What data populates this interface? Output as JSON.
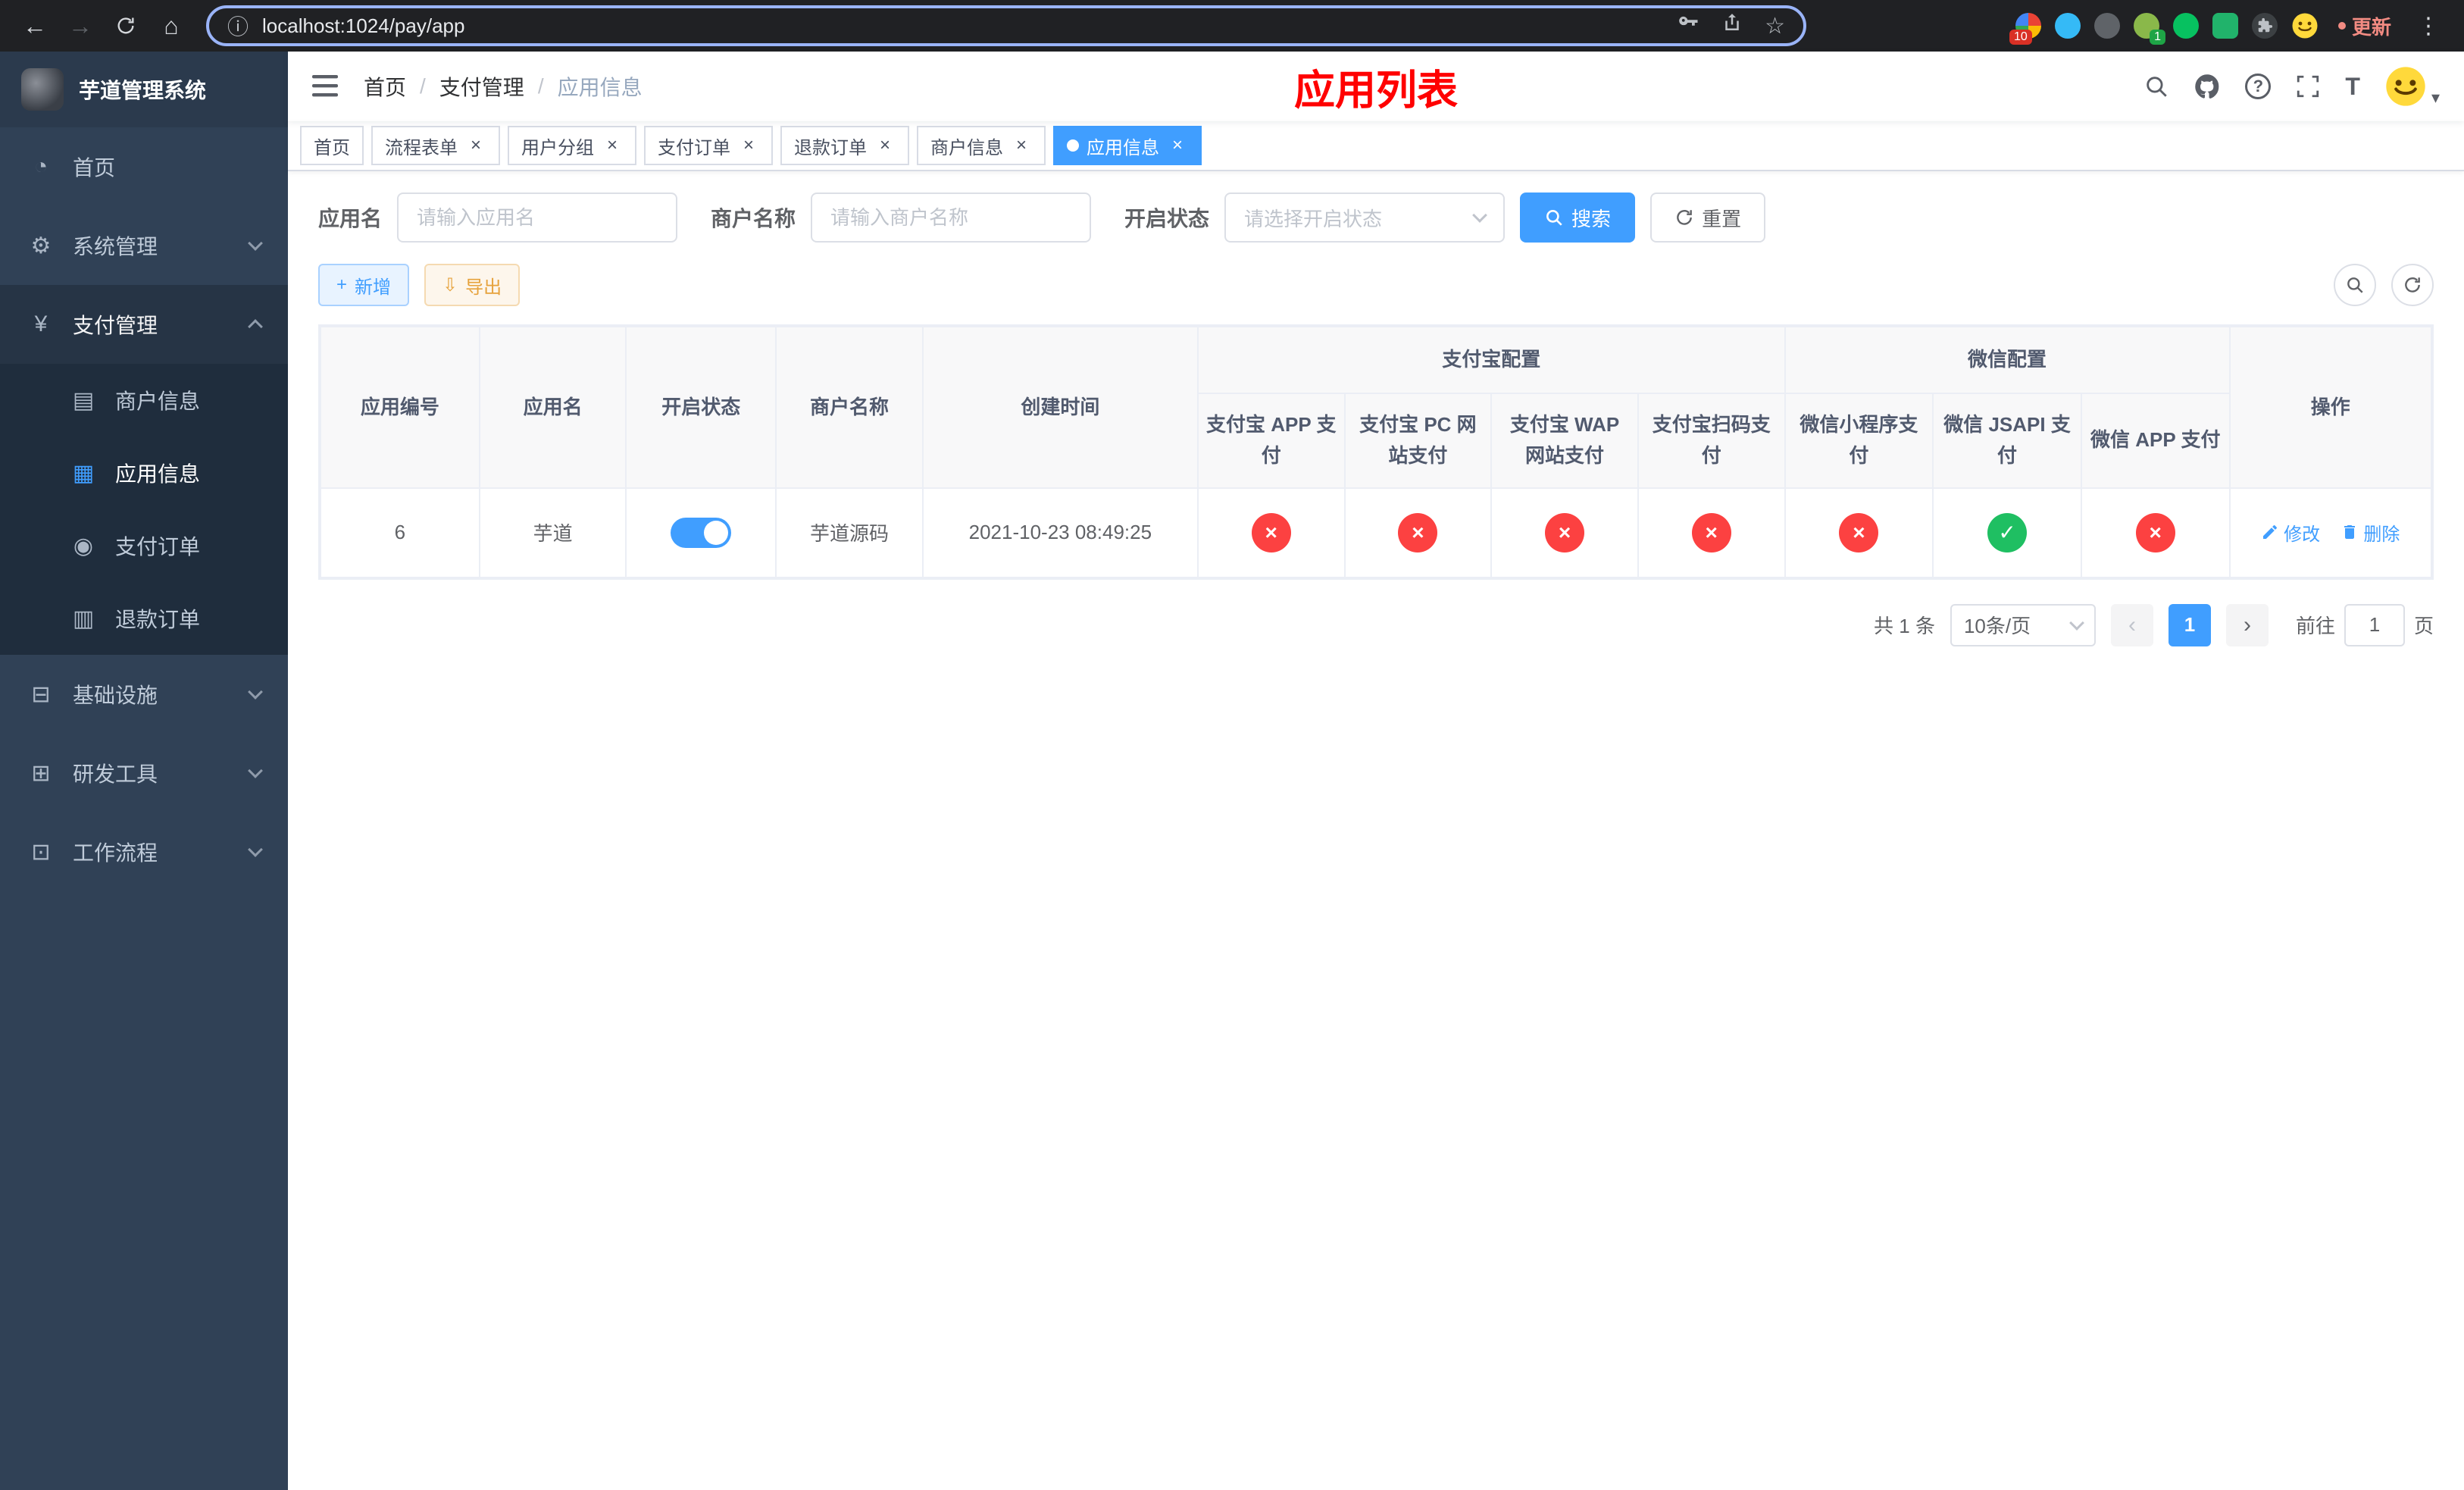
{
  "colors": {
    "accent": "#409eff",
    "danger": "#fc4141",
    "success": "#1fbf62",
    "title_red": "#ff0000",
    "sidebar_bg": "#304156",
    "submenu_bg": "#1f2d3d"
  },
  "icons": {
    "back": "←",
    "forward": "→",
    "home": "⌂",
    "info": "ⓘ",
    "star": "☆",
    "kebab": "⋮",
    "slash": "/",
    "close": "×",
    "help": "?",
    "font_size": "T",
    "caret": "▾",
    "plus": "+",
    "download": "⇩",
    "prev": "‹",
    "next": "›",
    "dashboard": "◔",
    "gear": "⚙",
    "yen": "¥",
    "card": "▤",
    "grid": "▦",
    "order": "◉",
    "refund": "▥",
    "infra": "⊟",
    "devtool": "⊞",
    "workflow": "⊡"
  },
  "browser": {
    "url": "localhost:1024/pay/app",
    "update_label": "更新",
    "ext_badge_10": "10",
    "ext_badge_1": "1"
  },
  "sidebar": {
    "title": "芋道管理系统",
    "items": [
      {
        "label": "首页"
      },
      {
        "label": "系统管理"
      },
      {
        "label": "支付管理",
        "children": [
          {
            "label": "商户信息"
          },
          {
            "label": "应用信息"
          },
          {
            "label": "支付订单"
          },
          {
            "label": "退款订单"
          }
        ]
      },
      {
        "label": "基础设施"
      },
      {
        "label": "研发工具"
      },
      {
        "label": "工作流程"
      }
    ]
  },
  "header": {
    "breadcrumb": [
      "首页",
      "支付管理",
      "应用信息"
    ],
    "title": "应用列表"
  },
  "tabs": {
    "items": [
      {
        "label": "首页"
      },
      {
        "label": "流程表单"
      },
      {
        "label": "用户分组"
      },
      {
        "label": "支付订单"
      },
      {
        "label": "退款订单"
      },
      {
        "label": "商户信息"
      },
      {
        "label": "应用信息"
      }
    ]
  },
  "filters": {
    "app_name_label": "应用名",
    "app_name_placeholder": "请输入应用名",
    "merchant_label": "商户名称",
    "merchant_placeholder": "请输入商户名称",
    "status_label": "开启状态",
    "status_placeholder": "请选择开启状态",
    "search_label": "搜索",
    "reset_label": "重置"
  },
  "toolbar": {
    "add_label": "新增",
    "export_label": "导出"
  },
  "table": {
    "columns": {
      "id": "应用编号",
      "name": "应用名",
      "status": "开启状态",
      "merchant": "商户名称",
      "created": "创建时间",
      "group_alipay": "支付宝配置",
      "group_wechat": "微信配置",
      "alipay_app": "支付宝 APP 支付",
      "alipay_pc": "支付宝 PC 网站支付",
      "alipay_wap": "支付宝 WAP 网站支付",
      "alipay_qr": "支付宝扫码支付",
      "wx_mini": "微信小程序支付",
      "wx_jsapi": "微信 JSAPI 支付",
      "wx_app": "微信 APP 支付",
      "actions": "操作"
    },
    "rows": [
      {
        "id": "6",
        "name": "芋道",
        "enabled": "on",
        "merchant": "芋道源码",
        "created": "2021-10-23 08:49:25",
        "statuses": {
          "alipay_app": "no",
          "alipay_pc": "no",
          "alipay_wap": "no",
          "alipay_qr": "no",
          "wx_mini": "no",
          "wx_jsapi": "yes",
          "wx_app": "no"
        },
        "edit_label": "修改",
        "delete_label": "删除"
      }
    ]
  },
  "pagination": {
    "total": "共 1 条",
    "page_size": "10条/页",
    "page": "1",
    "goto_label": "前往",
    "goto_value": "1",
    "unit_label": "页"
  }
}
